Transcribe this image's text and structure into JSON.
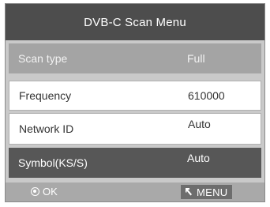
{
  "window": {
    "title": "DVB-C Scan Menu"
  },
  "rows": [
    {
      "label": "Scan type",
      "value": "Full"
    },
    {
      "label": "Frequency",
      "value": "610000"
    },
    {
      "label": "Network ID",
      "value": "Auto"
    },
    {
      "label": "Symbol(KS/S)",
      "value": "Auto"
    }
  ],
  "footer": {
    "ok_label": "OK",
    "ok_icon": "ok-circle-icon",
    "menu_label": "MENU",
    "menu_icon": "return-arrow-icon"
  },
  "colors": {
    "title_bar": "#4d4d4d",
    "selected_row": "#575757",
    "disabled_row": "#a4a4a4",
    "footer": "#a9a9a9"
  }
}
